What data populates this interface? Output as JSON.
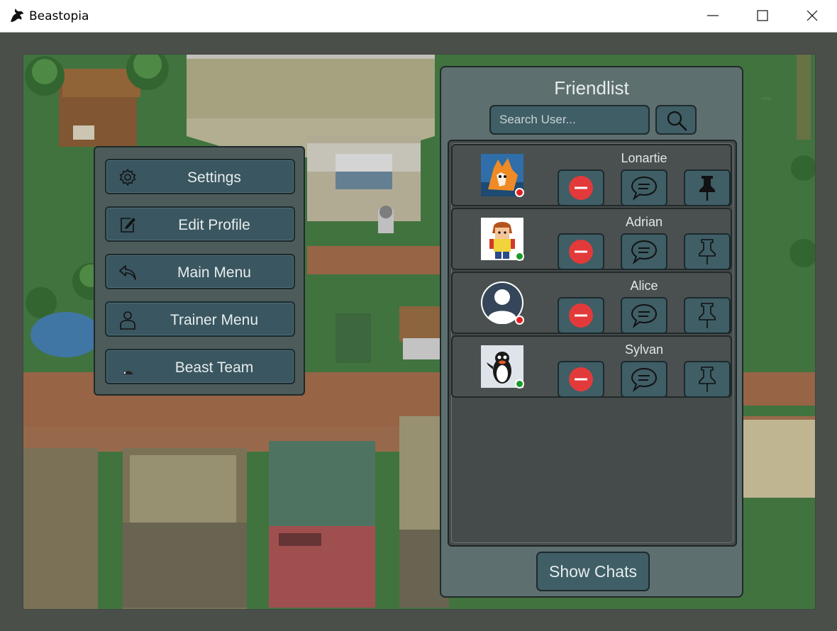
{
  "window": {
    "title": "Beastopia",
    "icon": "dragon-logo-icon",
    "controls": [
      "minimize-icon",
      "maximize-icon",
      "close-icon"
    ]
  },
  "menu": {
    "items": [
      {
        "label": "Settings",
        "icon": "gear-icon"
      },
      {
        "label": "Edit Profile",
        "icon": "edit-icon"
      },
      {
        "label": "Main Menu",
        "icon": "back-arrow-icon"
      },
      {
        "label": "Trainer Menu",
        "icon": "person-icon"
      },
      {
        "label": "Beast Team",
        "icon": "beast-icon"
      }
    ]
  },
  "friendlist": {
    "title": "Friendlist",
    "search_placeholder": "Search User...",
    "search_icon": "search-icon",
    "friends": [
      {
        "name": "Lonartie",
        "status": "offline",
        "status_color": "#e02020",
        "pinned": true
      },
      {
        "name": "Adrian",
        "status": "online",
        "status_color": "#1a9a2a",
        "pinned": false
      },
      {
        "name": "Alice",
        "status": "offline",
        "status_color": "#e02020",
        "pinned": false
      },
      {
        "name": "Sylvan",
        "status": "online",
        "status_color": "#1a9a2a",
        "pinned": false
      }
    ],
    "show_chats_label": "Show Chats"
  }
}
